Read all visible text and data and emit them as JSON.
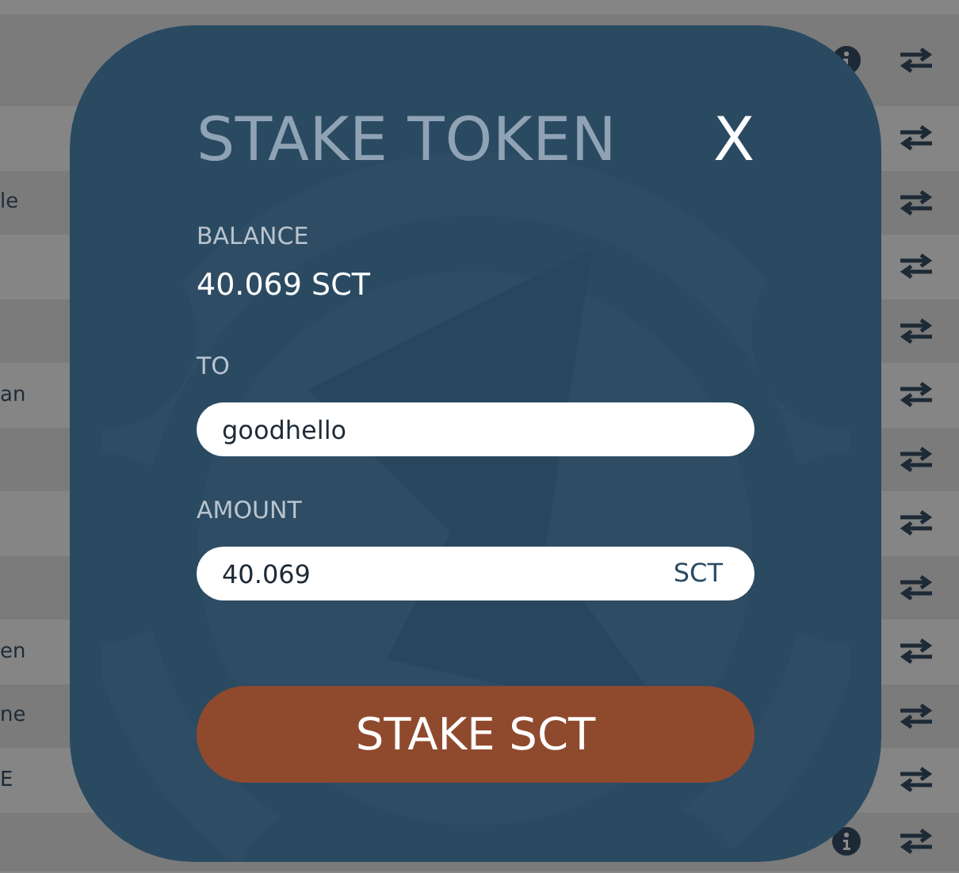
{
  "background_rows": [
    {
      "text": "",
      "info": true
    },
    {
      "text": "",
      "info": false
    },
    {
      "text": "le",
      "info": false
    },
    {
      "text": "",
      "info": false
    },
    {
      "text": "",
      "info": false
    },
    {
      "text": "an",
      "info": false
    },
    {
      "text": "",
      "info": false
    },
    {
      "text": "",
      "info": false
    },
    {
      "text": "",
      "info": false
    },
    {
      "text": "en",
      "info": false
    },
    {
      "text": "ne",
      "info": false
    },
    {
      "text": "E",
      "info": false
    },
    {
      "text": "",
      "info": true
    }
  ],
  "modal": {
    "title": "STAKE TOKEN",
    "close": "X",
    "balance": {
      "label": "BALANCE",
      "value": "40.069 SCT"
    },
    "to": {
      "label": "TO",
      "value": "goodhello"
    },
    "amount": {
      "label": "AMOUNT",
      "value": "40.069",
      "unit": "SCT"
    },
    "submit": "STAKE SCT"
  }
}
